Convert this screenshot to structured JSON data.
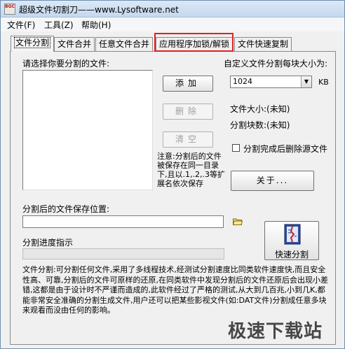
{
  "window": {
    "app_icon_text": "BGC",
    "title": "超级文件切割刀——www.Lysoftware.net"
  },
  "menu": {
    "items": [
      "文件(F)",
      "工具(Z)",
      "帮助(H)"
    ]
  },
  "tabs": [
    {
      "label": "文件分割",
      "active": true
    },
    {
      "label": "文件合并",
      "active": false
    },
    {
      "label": "任意文件合并",
      "active": false
    },
    {
      "label": "应用程序加锁/解锁",
      "active": false,
      "highlighted": true
    },
    {
      "label": "文件快速复制",
      "active": false
    }
  ],
  "split": {
    "select_files_label": "请选择你要分割的文件:",
    "add_button": "添加",
    "delete_button": "删除",
    "clear_button": "清空",
    "custom_size_label": "自定义文件分割每块大小为:",
    "size_value": "1024",
    "size_unit": "KB",
    "file_size_text": "文件大小:(未知)",
    "block_count_text": "分割块数:(未知)",
    "delete_source_label": "分割完成后删除源文件",
    "delete_source_checked": false,
    "note_text": "注意:分割后的文件被保存在同一目录下,且以.1,.2,.3等扩展名依次保存",
    "about_button": "关于...",
    "save_location_label": "分割后的文件保存位置:",
    "save_location_value": "",
    "progress_label": "分割进度指示",
    "progress_fraction": 0,
    "quick_split_button": "快速分割",
    "description": "文件分割:可分割任何文件,采用了多线程技术,经测试分割速度比同类软件速度快,而且安全性高、可靠,分割后的文件可原样的还原,在同类软件中发现分割后的文件还原后会出现小差错,这都是由于设计时不严谨而造成的,此软件经过了严格的测试,从大到几百兆,小到几K,都能非常安全准确的分割生成文件,用户还可以把某些影视文件(如:DAT文件)分割成任意多块来观看而没由任何的影响。"
  },
  "watermark": "极速下载站",
  "colors": {
    "tab_highlight": "#e02020",
    "progress_fill": "#3c9c3c"
  }
}
